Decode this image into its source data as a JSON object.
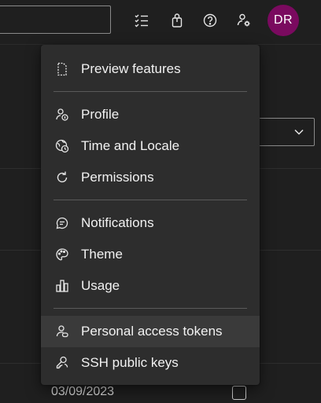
{
  "header": {
    "avatar_initials": "DR",
    "avatar_color": "#7a0a5f",
    "icons": [
      "task-list-icon",
      "marketplace-bag-icon",
      "help-icon",
      "user-settings-icon"
    ]
  },
  "menu": {
    "groups": [
      [
        {
          "label": "Preview features",
          "icon": "document-icon"
        }
      ],
      [
        {
          "label": "Profile",
          "icon": "profile-icon"
        },
        {
          "label": "Time and Locale",
          "icon": "globe-clock-icon"
        },
        {
          "label": "Permissions",
          "icon": "refresh-icon"
        }
      ],
      [
        {
          "label": "Notifications",
          "icon": "chat-bubble-icon"
        },
        {
          "label": "Theme",
          "icon": "palette-icon"
        },
        {
          "label": "Usage",
          "icon": "bar-chart-icon"
        }
      ],
      [
        {
          "label": "Personal access tokens",
          "icon": "person-key-icon"
        },
        {
          "label": "SSH public keys",
          "icon": "key-people-icon"
        }
      ]
    ],
    "hovered_item": "Personal access tokens"
  },
  "background": {
    "date_text": "03/09/2023"
  }
}
